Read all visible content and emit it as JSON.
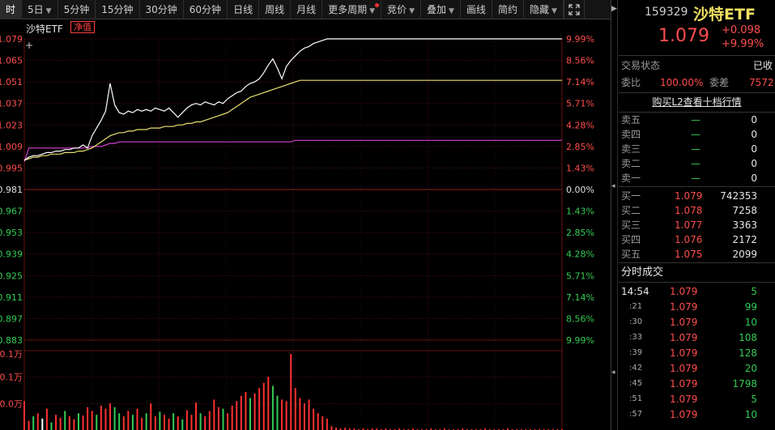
{
  "toolbar": {
    "items": [
      {
        "label": "时",
        "arrow": false,
        "active": true
      },
      {
        "label": "5日",
        "arrow": true
      },
      {
        "label": "5分钟",
        "arrow": false
      },
      {
        "label": "15分钟",
        "arrow": false
      },
      {
        "label": "30分钟",
        "arrow": false
      },
      {
        "label": "60分钟",
        "arrow": false
      },
      {
        "label": "日线",
        "arrow": false
      },
      {
        "label": "周线",
        "arrow": false
      },
      {
        "label": "月线",
        "arrow": false
      },
      {
        "label": "更多周期",
        "arrow": true,
        "dot": true
      },
      {
        "label": "竞价",
        "arrow": true
      },
      {
        "label": "叠加",
        "arrow": true
      },
      {
        "label": "画线",
        "arrow": false
      },
      {
        "label": "简约",
        "arrow": false
      },
      {
        "label": "隐藏",
        "arrow": true
      }
    ],
    "expand_icon": "expand-icon"
  },
  "chart": {
    "name": "沙特ETF",
    "nav_badge": "净值",
    "price_axis": [
      "1.079",
      "1.065",
      "1.051",
      "1.037",
      "1.023",
      "1.009",
      "0.995",
      "0.981",
      "0.967",
      "0.953",
      "0.939",
      "0.925",
      "0.911",
      "0.897",
      "0.883"
    ],
    "pct_axis": [
      "9.99%",
      "8.56%",
      "7.14%",
      "5.71%",
      "4.28%",
      "2.85%",
      "1.43%",
      "0.00%",
      "1.43%",
      "2.85%",
      "4.28%",
      "5.71%",
      "7.14%",
      "8.56%",
      "9.99%"
    ],
    "vol_axis": [
      "0.1万",
      "0.1万",
      "0.0万"
    ],
    "colors": {
      "price": "#ffffff",
      "avg": "#e8e070",
      "nav": "#d040d0",
      "up": "#ff3030",
      "flat": "#ffffff",
      "down": "#33cc55",
      "grid": "#4a0f0f"
    }
  },
  "chart_data": {
    "type": "line",
    "preclose": 0.981,
    "ylim": [
      0.883,
      1.079
    ],
    "vol_max_label": "0.1万",
    "series": [
      {
        "name": "price",
        "values": [
          1.0,
          1.002,
          1.003,
          1.003,
          1.004,
          1.005,
          1.005,
          1.006,
          1.006,
          1.007,
          1.007,
          1.008,
          1.008,
          1.01,
          1.008,
          1.016,
          1.021,
          1.026,
          1.032,
          1.05,
          1.036,
          1.031,
          1.03,
          1.032,
          1.031,
          1.033,
          1.032,
          1.033,
          1.032,
          1.034,
          1.033,
          1.032,
          1.034,
          1.031,
          1.028,
          1.031,
          1.034,
          1.036,
          1.037,
          1.036,
          1.038,
          1.037,
          1.036,
          1.038,
          1.037,
          1.04,
          1.042,
          1.044,
          1.045,
          1.048,
          1.05,
          1.051,
          1.053,
          1.057,
          1.062,
          1.066,
          1.06,
          1.053,
          1.061,
          1.065,
          1.068,
          1.071,
          1.073,
          1.074,
          1.076,
          1.077,
          1.078,
          1.079,
          1.079,
          1.079,
          1.079,
          1.079,
          1.079,
          1.079,
          1.079,
          1.079,
          1.079,
          1.079,
          1.079,
          1.079,
          1.079,
          1.079,
          1.079,
          1.079,
          1.079,
          1.079,
          1.079,
          1.079,
          1.079,
          1.079,
          1.079,
          1.079,
          1.079,
          1.079,
          1.079,
          1.079,
          1.079,
          1.079,
          1.079,
          1.079,
          1.079,
          1.079,
          1.079,
          1.079,
          1.079,
          1.079,
          1.079,
          1.079,
          1.079,
          1.079,
          1.079,
          1.079,
          1.079,
          1.079,
          1.079,
          1.079,
          1.079,
          1.079,
          1.079,
          1.079
        ]
      },
      {
        "name": "avg",
        "values": [
          1.0,
          1.001,
          1.002,
          1.002,
          1.003,
          1.003,
          1.004,
          1.004,
          1.004,
          1.005,
          1.005,
          1.005,
          1.006,
          1.006,
          1.007,
          1.008,
          1.01,
          1.012,
          1.014,
          1.016,
          1.017,
          1.018,
          1.018,
          1.019,
          1.019,
          1.02,
          1.02,
          1.02,
          1.021,
          1.021,
          1.021,
          1.022,
          1.022,
          1.022,
          1.023,
          1.023,
          1.024,
          1.024,
          1.025,
          1.025,
          1.026,
          1.027,
          1.028,
          1.029,
          1.03,
          1.031,
          1.033,
          1.035,
          1.037,
          1.039,
          1.041,
          1.042,
          1.043,
          1.044,
          1.045,
          1.046,
          1.047,
          1.048,
          1.049,
          1.05,
          1.051,
          1.052,
          1.052,
          1.052,
          1.052,
          1.052,
          1.052,
          1.052,
          1.052,
          1.052,
          1.052,
          1.052,
          1.052,
          1.052,
          1.052,
          1.052,
          1.052,
          1.052,
          1.052,
          1.052,
          1.052,
          1.052,
          1.052,
          1.052,
          1.052,
          1.052,
          1.052,
          1.052,
          1.052,
          1.052,
          1.052,
          1.052,
          1.052,
          1.052,
          1.052,
          1.052,
          1.052,
          1.052,
          1.052,
          1.052,
          1.052,
          1.052,
          1.052,
          1.052,
          1.052,
          1.052,
          1.052,
          1.052,
          1.052,
          1.052,
          1.052,
          1.052,
          1.052,
          1.052,
          1.052,
          1.052,
          1.052,
          1.052,
          1.052,
          1.052
        ]
      },
      {
        "name": "nav",
        "values": [
          0.999,
          1.008,
          1.008,
          1.008,
          1.008,
          1.008,
          1.008,
          1.008,
          1.008,
          1.008,
          1.008,
          1.008,
          1.008,
          1.008,
          1.008,
          1.009,
          1.009,
          1.009,
          1.01,
          1.011,
          1.011,
          1.012,
          1.012,
          1.012,
          1.012,
          1.012,
          1.012,
          1.012,
          1.012,
          1.012,
          1.012,
          1.012,
          1.012,
          1.012,
          1.012,
          1.012,
          1.012,
          1.012,
          1.012,
          1.012,
          1.012,
          1.012,
          1.012,
          1.012,
          1.012,
          1.012,
          1.012,
          1.012,
          1.012,
          1.012,
          1.012,
          1.012,
          1.012,
          1.012,
          1.012,
          1.012,
          1.012,
          1.012,
          1.012,
          1.012,
          1.013,
          1.013,
          1.013,
          1.013,
          1.013,
          1.013,
          1.013,
          1.013,
          1.013,
          1.013,
          1.013,
          1.013,
          1.013,
          1.013,
          1.013,
          1.013,
          1.013,
          1.013,
          1.013,
          1.013,
          1.013,
          1.013,
          1.013,
          1.013,
          1.013,
          1.013,
          1.013,
          1.013,
          1.013,
          1.013,
          1.013,
          1.013,
          1.013,
          1.013,
          1.013,
          1.013,
          1.013,
          1.013,
          1.013,
          1.013,
          1.013,
          1.013,
          1.013,
          1.013,
          1.013,
          1.013,
          1.013,
          1.013,
          1.013,
          1.013,
          1.013,
          1.013,
          1.013,
          1.013,
          1.013,
          1.013,
          1.013,
          1.013,
          1.013,
          1.013
        ]
      },
      {
        "name": "volume",
        "values": [
          0.38,
          0.12,
          0.18,
          0.22,
          0.15,
          0.28,
          0.1,
          0.2,
          0.16,
          0.25,
          0.18,
          0.14,
          0.22,
          0.19,
          0.3,
          0.25,
          0.2,
          0.32,
          0.28,
          0.35,
          0.3,
          0.22,
          0.18,
          0.25,
          0.2,
          0.28,
          0.16,
          0.22,
          0.35,
          0.18,
          0.24,
          0.2,
          0.15,
          0.22,
          0.18,
          0.14,
          0.26,
          0.2,
          0.36,
          0.22,
          0.18,
          0.25,
          0.4,
          0.3,
          0.28,
          0.22,
          0.32,
          0.38,
          0.45,
          0.5,
          0.42,
          0.48,
          0.55,
          0.62,
          0.7,
          0.58,
          0.45,
          0.4,
          0.38,
          1.0,
          0.55,
          0.42,
          0.35,
          0.4,
          0.28,
          0.22,
          0.18,
          0.15,
          0.05,
          0.03,
          0.02,
          0.03,
          0.02,
          0.02,
          0.01,
          0.02,
          0.01,
          0.02,
          0.02,
          0.01,
          0.02,
          0.01,
          0.01,
          0.02,
          0.01,
          0.01,
          0.02,
          0.01,
          0.01,
          0.01,
          0.02,
          0.01,
          0.01,
          0.02,
          0.01,
          0.01,
          0.01,
          0.02,
          0.01,
          0.01,
          0.01,
          0.01,
          0.02,
          0.01,
          0.01,
          0.01,
          0.01,
          0.02,
          0.01,
          0.01,
          0.01,
          0.01,
          0.01,
          0.01,
          0.01,
          0.01,
          0.01,
          0.01,
          0.01,
          0.01
        ]
      },
      {
        "name": "volume_dir",
        "values": [
          1,
          1,
          -1,
          1,
          0,
          1,
          -1,
          1,
          1,
          -1,
          1,
          1,
          -1,
          1,
          1,
          1,
          -1,
          1,
          1,
          1,
          -1,
          -1,
          1,
          1,
          -1,
          1,
          1,
          -1,
          1,
          1,
          -1,
          1,
          1,
          -1,
          1,
          -1,
          1,
          1,
          1,
          -1,
          1,
          1,
          1,
          1,
          -1,
          1,
          1,
          1,
          1,
          1,
          -1,
          1,
          1,
          1,
          1,
          -1,
          -1,
          1,
          1,
          1,
          1,
          1,
          1,
          1,
          1,
          1,
          1,
          1,
          1,
          1,
          1,
          1,
          1,
          1,
          1,
          1,
          1,
          1,
          1,
          1,
          1,
          1,
          1,
          1,
          1,
          1,
          1,
          1,
          1,
          1,
          1,
          1,
          1,
          1,
          1,
          1,
          1,
          1,
          1,
          1,
          1,
          1,
          1,
          1,
          1,
          1,
          1,
          1,
          1,
          1,
          1,
          1,
          1,
          1,
          1,
          1,
          1,
          1,
          1,
          1
        ]
      }
    ]
  },
  "quote": {
    "code": "159329",
    "name": "沙特ETF",
    "price": "1.079",
    "change": "+0.098",
    "pct": "+9.99%",
    "trade_status_label": "交易状态",
    "trade_status_value": "已收",
    "weibi_label": "委比",
    "weibi_value": "100.00%",
    "weicha_label": "委差",
    "weicha_value": "7572",
    "l2_link": "购买L2查看十档行情"
  },
  "sells": [
    {
      "label": "卖五",
      "price": "—",
      "vol": "0"
    },
    {
      "label": "卖四",
      "price": "—",
      "vol": "0"
    },
    {
      "label": "卖三",
      "price": "—",
      "vol": "0"
    },
    {
      "label": "卖二",
      "price": "—",
      "vol": "0"
    },
    {
      "label": "卖一",
      "price": "—",
      "vol": "0"
    }
  ],
  "buys": [
    {
      "label": "买一",
      "price": "1.079",
      "vol": "742353"
    },
    {
      "label": "买二",
      "price": "1.078",
      "vol": "7258"
    },
    {
      "label": "买三",
      "price": "1.077",
      "vol": "3363"
    },
    {
      "label": "买四",
      "price": "1.076",
      "vol": "2172"
    },
    {
      "label": "买五",
      "price": "1.075",
      "vol": "2099"
    }
  ],
  "ticks": {
    "title": "分时成交",
    "rows": [
      {
        "time": "14:54",
        "price": "1.079",
        "vol": "5"
      },
      {
        "time": ":21",
        "price": "1.079",
        "vol": "99"
      },
      {
        "time": ":30",
        "price": "1.079",
        "vol": "10"
      },
      {
        "time": ":33",
        "price": "1.079",
        "vol": "108"
      },
      {
        "time": ":39",
        "price": "1.079",
        "vol": "128"
      },
      {
        "time": ":42",
        "price": "1.079",
        "vol": "20"
      },
      {
        "time": ":45",
        "price": "1.079",
        "vol": "1798"
      },
      {
        "time": ":51",
        "price": "1.079",
        "vol": "5"
      },
      {
        "time": ":57",
        "price": "1.079",
        "vol": "10"
      }
    ]
  }
}
